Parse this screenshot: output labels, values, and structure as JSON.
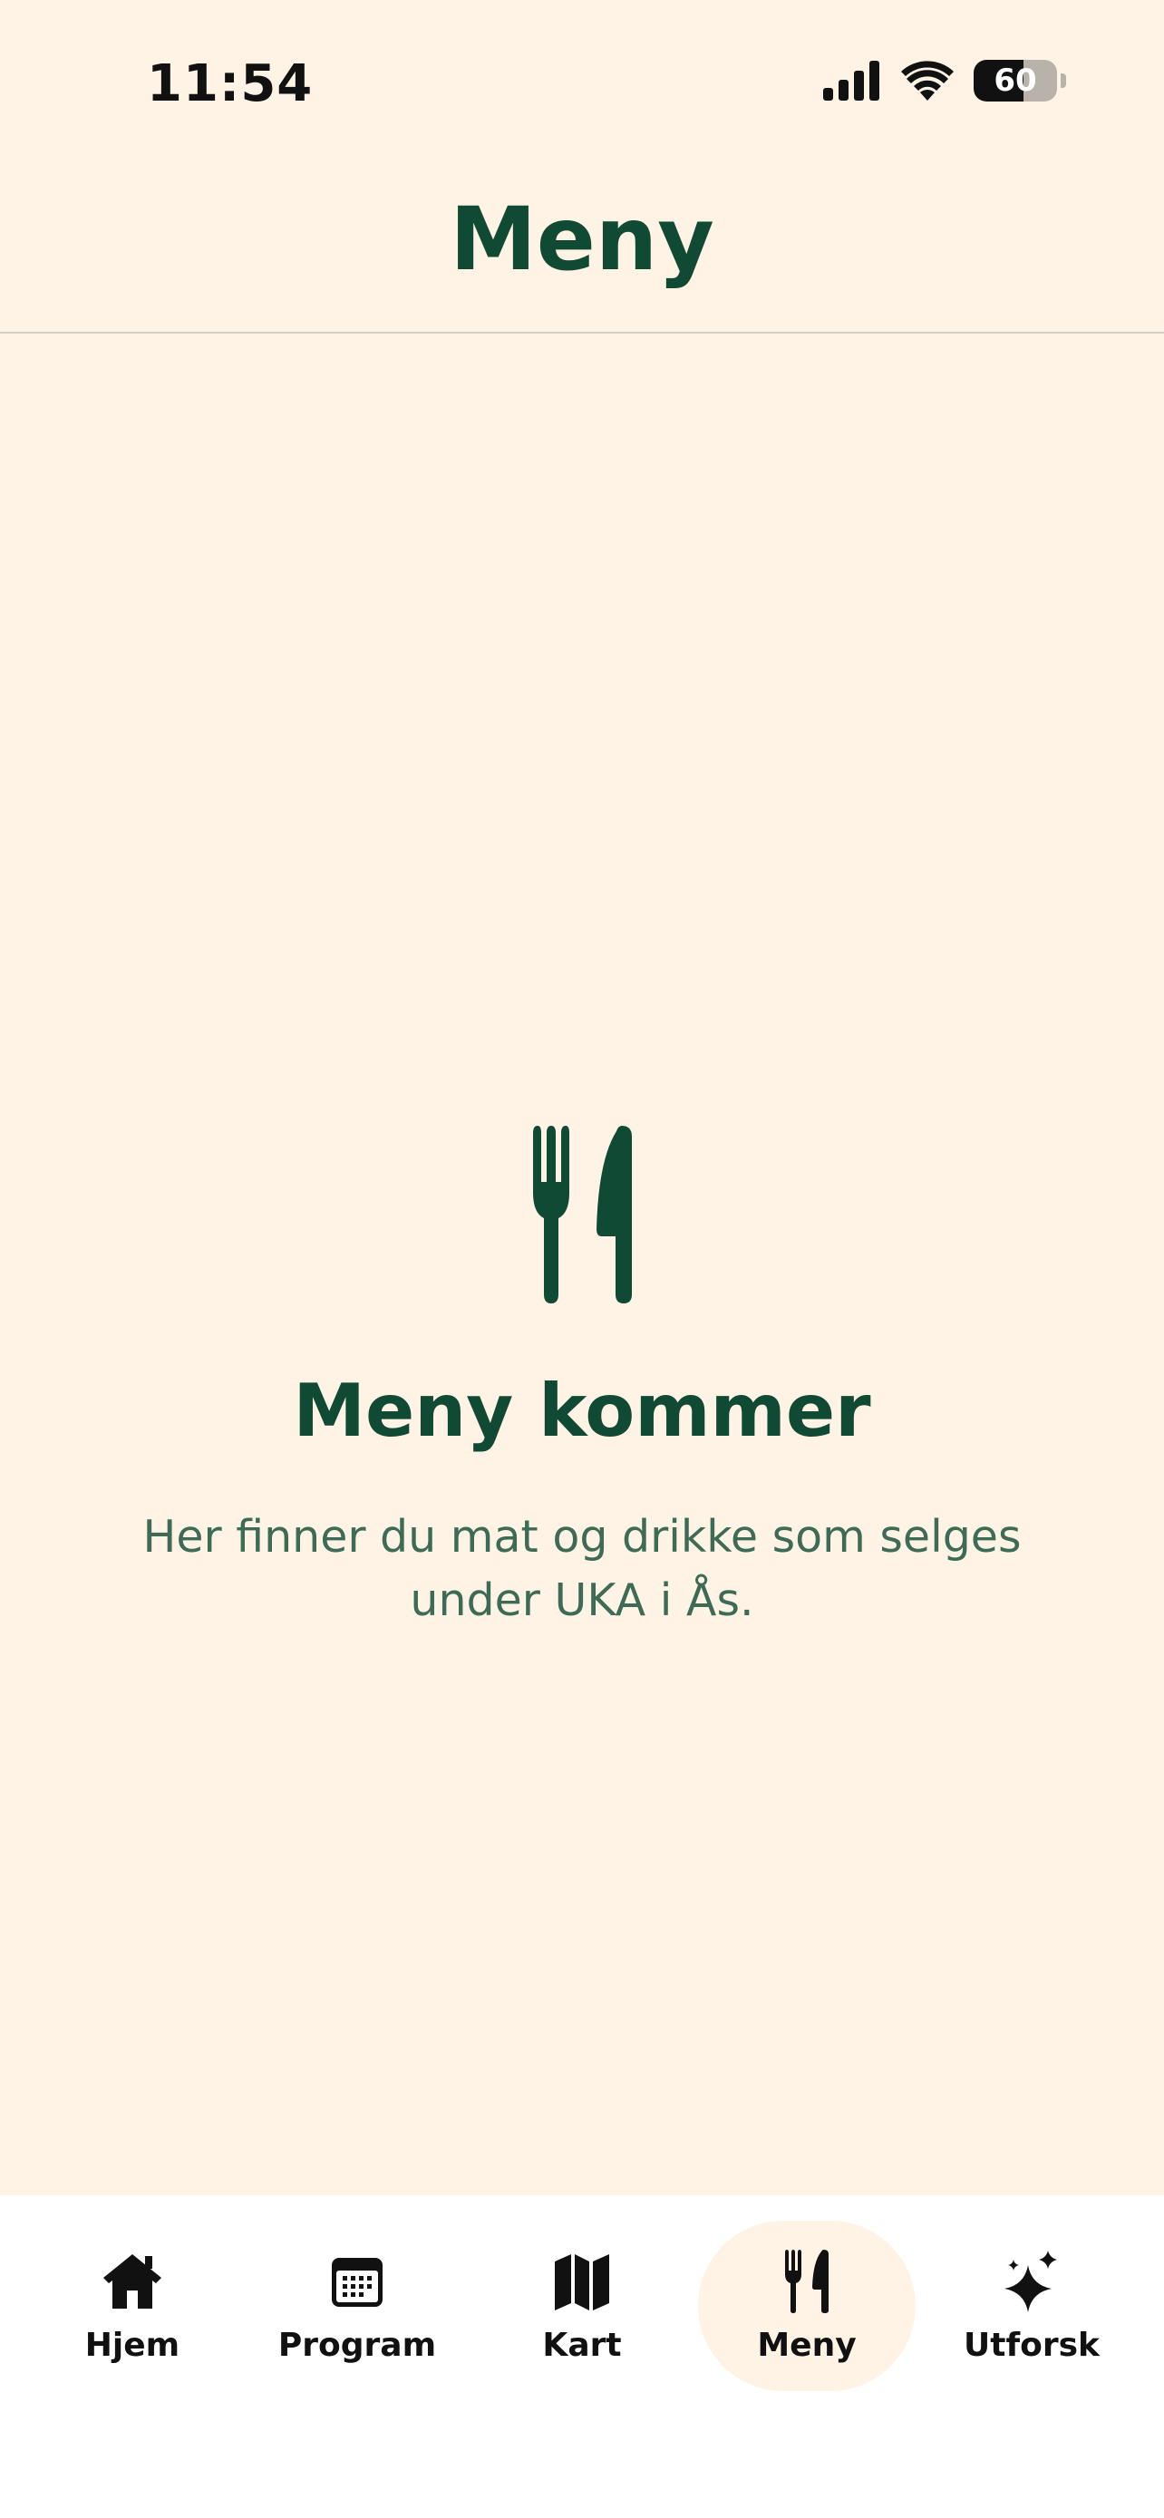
{
  "status_bar": {
    "time": "11:54",
    "battery_level": "60",
    "battery_fraction": 0.6
  },
  "header": {
    "title": "Meny"
  },
  "empty_state": {
    "icon": "fork-knife-icon",
    "title": "Meny kommer",
    "description": "Her finner du mat og drikke som selges under UKA i Ås."
  },
  "tab_bar": {
    "active": "Meny",
    "tabs": [
      {
        "label": "Hjem",
        "icon": "home-icon"
      },
      {
        "label": "Program",
        "icon": "calendar-icon"
      },
      {
        "label": "Kart",
        "icon": "map-icon"
      },
      {
        "label": "Meny",
        "icon": "fork-knife-icon"
      },
      {
        "label": "Utforsk",
        "icon": "sparkles-icon"
      }
    ]
  },
  "colors": {
    "background": "#fef3e5",
    "brand_green": "#114a34",
    "muted_green": "#3d6b56",
    "tab_bar_bg": "#ffffff"
  }
}
